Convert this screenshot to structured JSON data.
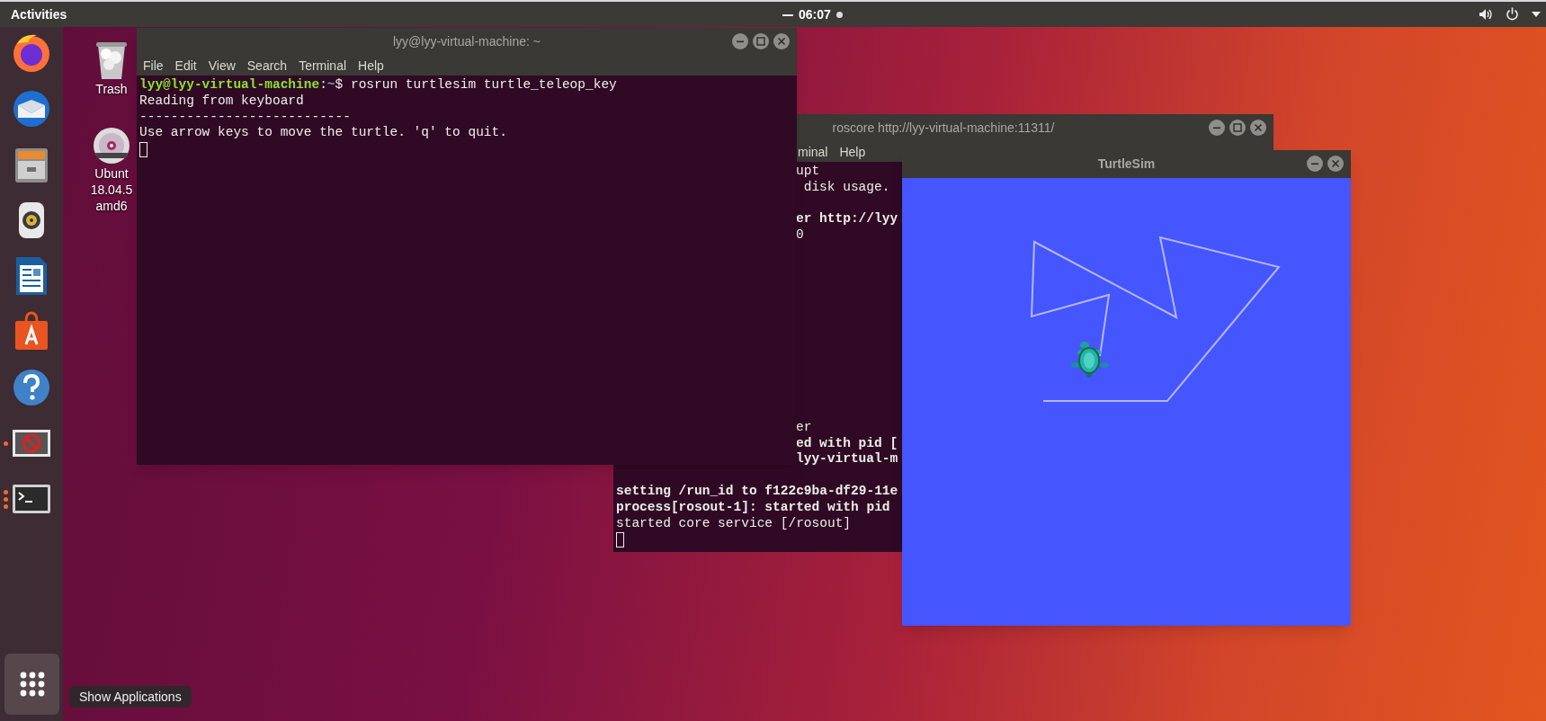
{
  "top_bar": {
    "activities": "Activities",
    "clock": "06:07"
  },
  "dock": {
    "items": [
      {
        "kind": "firefox",
        "running": false
      },
      {
        "kind": "thunderbird",
        "running": false
      },
      {
        "kind": "files",
        "running": false
      },
      {
        "kind": "rhythmbox",
        "running": false
      },
      {
        "kind": "writer",
        "running": false
      },
      {
        "kind": "software",
        "running": false
      },
      {
        "kind": "help",
        "running": false
      },
      {
        "kind": "app-window",
        "running": true,
        "multiple": false
      },
      {
        "kind": "terminal",
        "running": true,
        "multiple": true
      }
    ],
    "tooltip": "Show Applications"
  },
  "desktop_icons": [
    {
      "kind": "trash",
      "label_lines": [
        "Trash"
      ]
    },
    {
      "kind": "dvd",
      "label_lines": [
        "Ubunt",
        "18.04.5",
        "amd6"
      ]
    }
  ],
  "roscore_window": {
    "title": "roscore http://lyy-virtual-machine:11311/",
    "controls": [
      {
        "kind": "minimize"
      },
      {
        "kind": "maximize"
      },
      {
        "kind": "close"
      }
    ],
    "menu": [
      "minal",
      "Help"
    ],
    "lines": [
      {
        "kind": "fragment",
        "text": "upt",
        "bold": false
      },
      {
        "kind": "fragment",
        "text": " disk usage.",
        "bold": false
      },
      {
        "kind": "blank"
      },
      {
        "kind": "fragment",
        "text": "er http://lyy",
        "bold": true
      },
      {
        "kind": "fragment",
        "text": "0",
        "bold": false
      },
      {
        "kind": "blank"
      },
      {
        "kind": "blank"
      },
      {
        "kind": "blank"
      },
      {
        "kind": "blank"
      },
      {
        "kind": "blank"
      },
      {
        "kind": "blank"
      },
      {
        "kind": "blank"
      },
      {
        "kind": "blank"
      },
      {
        "kind": "blank"
      },
      {
        "kind": "blank"
      },
      {
        "kind": "blank"
      },
      {
        "kind": "fragment",
        "text": "er",
        "bold": false
      },
      {
        "kind": "fragment",
        "text": "ed with pid [",
        "bold": true
      },
      {
        "kind": "fragment",
        "text": "lyy-virtual-m",
        "bold": true
      },
      {
        "kind": "blank"
      },
      {
        "kind": "line",
        "text": "setting /run_id to f122c9ba-df29-11e",
        "bold": true
      },
      {
        "kind": "line",
        "text": "process[rosout-1]: started with pid",
        "bold": true
      },
      {
        "kind": "line",
        "text": "started core service [/rosout]",
        "bold": false
      },
      {
        "kind": "cursor"
      }
    ]
  },
  "terminal_window": {
    "title": "lyy@lyy-virtual-machine: ~",
    "controls": [
      {
        "kind": "minimize"
      },
      {
        "kind": "maximize"
      },
      {
        "kind": "close"
      }
    ],
    "menu": [
      "File",
      "Edit",
      "View",
      "Search",
      "Terminal",
      "Help"
    ],
    "lines": [
      {
        "kind": "prompt",
        "user_host": "lyy@lyy-virtual-machine",
        "separator": ":",
        "path": "~",
        "symbol": "$",
        "command": "rosrun turtlesim turtle_teleop_key"
      },
      {
        "kind": "line",
        "text": "Reading from keyboard",
        "bold": false
      },
      {
        "kind": "line",
        "text": "---------------------------",
        "bold": false
      },
      {
        "kind": "line",
        "text": "Use arrow keys to move the turtle. 'q' to quit.",
        "bold": false
      },
      {
        "kind": "cursor"
      }
    ]
  },
  "turtlesim_window": {
    "title": "TurtleSim",
    "controls": [
      {
        "kind": "minimize"
      },
      {
        "kind": "close"
      }
    ]
  }
}
